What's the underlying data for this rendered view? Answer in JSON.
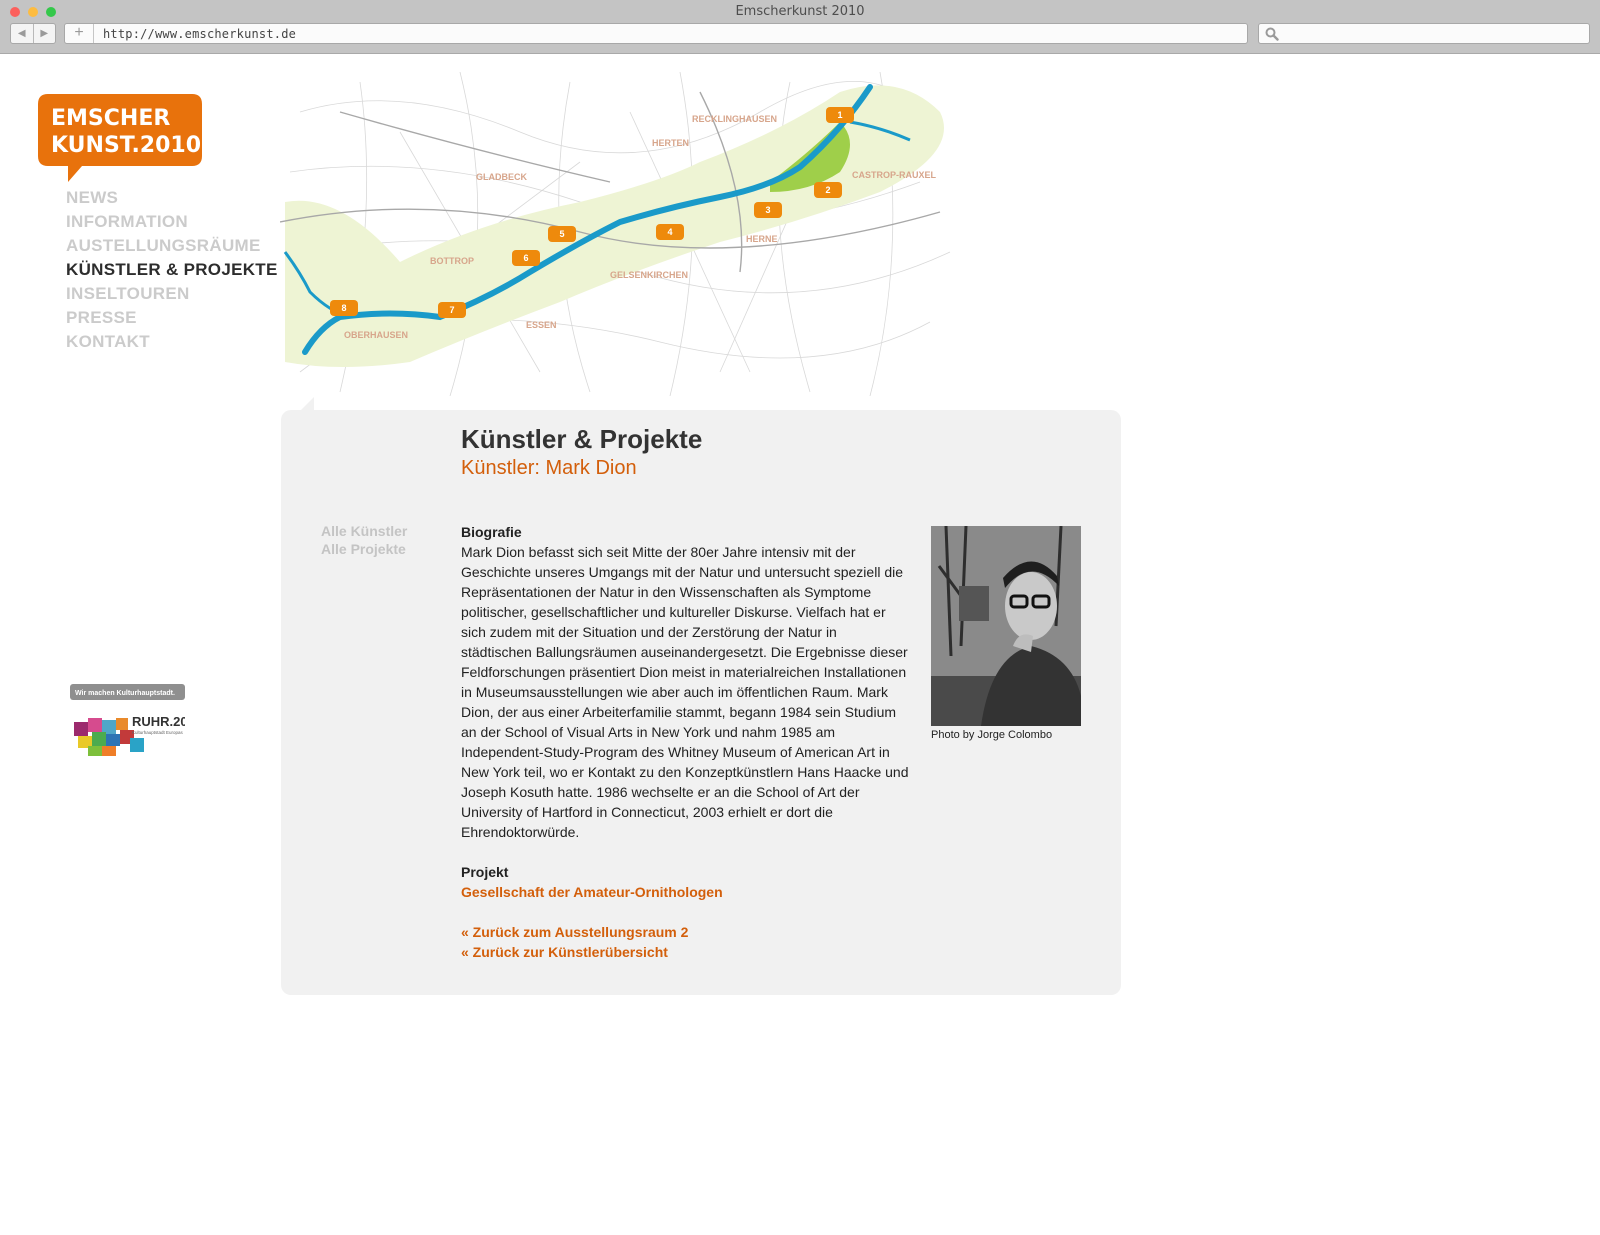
{
  "browser": {
    "window_title": "Emscherkunst 2010",
    "url": "http://www.emscherkunst.de"
  },
  "logo": {
    "line1": "EMSCHER",
    "line2": "KUNST.2010"
  },
  "nav": {
    "items": [
      "NEWS",
      "INFORMATION",
      "AUSTELLUNGSRÄUME",
      "KÜNSTLER & PROJEKTE",
      "INSELTOUREN",
      "PRESSE",
      "KONTAKT"
    ],
    "active": "KÜNSTLER & PROJEKTE"
  },
  "ruhr_badge": {
    "tagline": "Wir machen Kulturhauptstadt.",
    "name": "RUHR.2010",
    "sub": "Kulturhauptstadt Europas"
  },
  "map": {
    "cities": [
      "RECKLINGHAUSEN",
      "HERTEN",
      "GLADBECK",
      "CASTROP-RAUXEL",
      "HERNE",
      "BOTTROP",
      "GELSENKIRCHEN",
      "ESSEN",
      "OBERHAUSEN"
    ],
    "markers": [
      "1",
      "2",
      "3",
      "4",
      "5",
      "6",
      "7",
      "8"
    ]
  },
  "content": {
    "title": "Künstler & Projekte",
    "subtitle": "Künstler: Mark Dion",
    "subnav": [
      "Alle Künstler",
      "Alle Projekte"
    ],
    "bio_heading": "Biografie",
    "bio_text": "Mark Dion befasst sich seit Mitte der 80er Jahre intensiv mit der Geschichte unseres Umgangs mit der Natur und untersucht speziell die Repräsentationen der Natur in den Wissenschaften als Symptome politischer, gesellschaftlicher und kultureller Diskurse. Vielfach hat er sich zudem mit der Situation und der Zerstörung der Natur in städtischen Ballungsräumen auseinandergesetzt. Die Ergebnisse dieser Feldforschungen präsentiert Dion meist in materialreichen Installationen in Museumsausstellungen wie aber auch im öffentlichen Raum. Mark Dion, der aus einer Arbeiterfamilie stammt, begann 1984 sein Studium an der School of Visual Arts in New York und nahm 1985 am Independent-Study-Program des Whitney Museum of American Art in New York teil, wo er Kontakt zu den Konzeptkünstlern Hans Haacke und Joseph Kosuth hatte. 1986 wechselte er an die School of Art der University of Hartford in Connecticut, 2003 erhielt er dort die Ehrendoktorwürde.",
    "project_heading": "Projekt",
    "project_link": "Gesellschaft der Amateur-Ornithologen",
    "back_links": [
      "« Zurück zum Ausstellungsraum 2",
      "« Zurück zur Künstlerübersicht"
    ],
    "photo_caption": "Photo by Jorge Colombo"
  },
  "colors": {
    "accent": "#d35f0b",
    "logo_orange": "#e8720c",
    "river": "#1a9ac9",
    "panel": "#f1f1f1"
  }
}
